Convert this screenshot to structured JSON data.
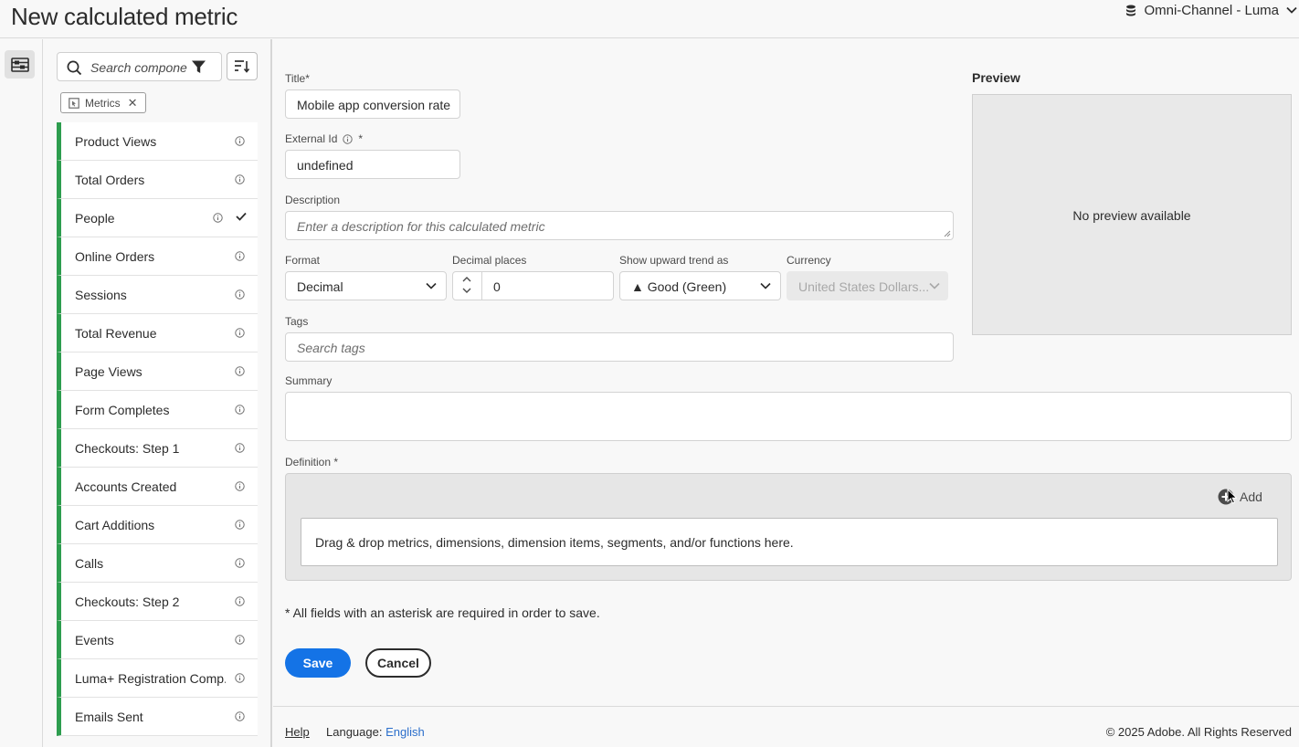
{
  "header": {
    "title": "New calculated metric",
    "report_suite": "Omni-Channel - Luma"
  },
  "rail": {
    "panel_toggle_icon": "panel-toggle-icon"
  },
  "components": {
    "search_placeholder": "Search components",
    "filter_chip": "Metrics",
    "items": [
      {
        "label": "Product Views",
        "selected": false
      },
      {
        "label": "Total Orders",
        "selected": false
      },
      {
        "label": "People",
        "selected": true
      },
      {
        "label": "Online Orders",
        "selected": false
      },
      {
        "label": "Sessions",
        "selected": false
      },
      {
        "label": "Total Revenue",
        "selected": false
      },
      {
        "label": "Page Views",
        "selected": false
      },
      {
        "label": "Form Completes",
        "selected": false
      },
      {
        "label": "Checkouts: Step 1",
        "selected": false
      },
      {
        "label": "Accounts Created",
        "selected": false
      },
      {
        "label": "Cart Additions",
        "selected": false
      },
      {
        "label": "Calls",
        "selected": false
      },
      {
        "label": "Checkouts: Step 2",
        "selected": false
      },
      {
        "label": "Events",
        "selected": false
      },
      {
        "label": "Luma+ Registration Comp...",
        "selected": false
      },
      {
        "label": "Emails Sent",
        "selected": false
      }
    ],
    "accent_color": "#2d9d4e"
  },
  "form": {
    "title_label": "Title",
    "title_value": "Mobile app conversion rate",
    "external_id_label": "External Id",
    "external_id_value": "undefined",
    "description_label": "Description",
    "description_placeholder": "Enter a description for this calculated metric",
    "format_label": "Format",
    "format_value": "Decimal",
    "decimal_label": "Decimal places",
    "decimal_value": "0",
    "trend_label": "Show upward trend as",
    "trend_value": "▲ Good (Green)",
    "currency_label": "Currency",
    "currency_value": "United States Dollars...",
    "tags_label": "Tags",
    "tags_placeholder": "Search tags",
    "summary_label": "Summary",
    "definition_label": "Definition",
    "add_label": "Add",
    "drop_text": "Drag & drop metrics, dimensions, dimension items, segments, and/or functions here.",
    "required_asterisk": "*",
    "required_note": "All fields with an asterisk are required in order to save.",
    "save_label": "Save",
    "cancel_label": "Cancel"
  },
  "preview": {
    "title": "Preview",
    "empty_text": "No preview available"
  },
  "footer": {
    "help": "Help",
    "language_label": "Language:",
    "language_value": "English",
    "copyright": "© 2025 Adobe. All Rights Reserved"
  },
  "colors": {
    "primary": "#1473e6",
    "link": "#2b6ecb"
  }
}
